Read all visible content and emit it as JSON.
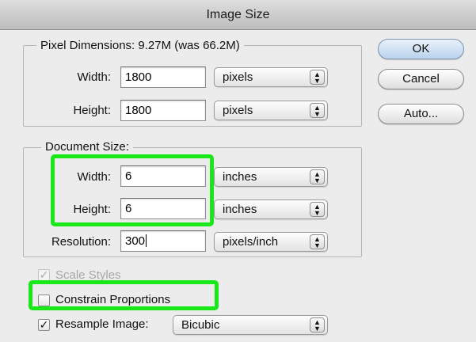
{
  "window": {
    "title": "Image Size"
  },
  "pixel_dimensions": {
    "legend": "Pixel Dimensions:  9.27M (was 66.2M)",
    "width_label": "Width:",
    "width_value": "1800",
    "width_unit": "pixels",
    "height_label": "Height:",
    "height_value": "1800",
    "height_unit": "pixels"
  },
  "document_size": {
    "legend": "Document Size:",
    "width_label": "Width:",
    "width_value": "6",
    "width_unit": "inches",
    "height_label": "Height:",
    "height_value": "6",
    "height_unit": "inches",
    "resolution_label": "Resolution:",
    "resolution_value": "300",
    "resolution_unit": "pixels/inch"
  },
  "options": {
    "scale_styles_label": "Scale Styles",
    "scale_styles_checked": true,
    "scale_styles_enabled": false,
    "constrain_label": "Constrain Proportions",
    "constrain_checked": false,
    "resample_label": "Resample Image:",
    "resample_checked": true,
    "resample_method": "Bicubic"
  },
  "buttons": {
    "ok": "OK",
    "cancel": "Cancel",
    "auto": "Auto..."
  },
  "glyphs": {
    "check": "✓",
    "stepper": "▲▼"
  },
  "colors": {
    "highlight": "#18e818",
    "default_button": "#b9d3ee"
  }
}
